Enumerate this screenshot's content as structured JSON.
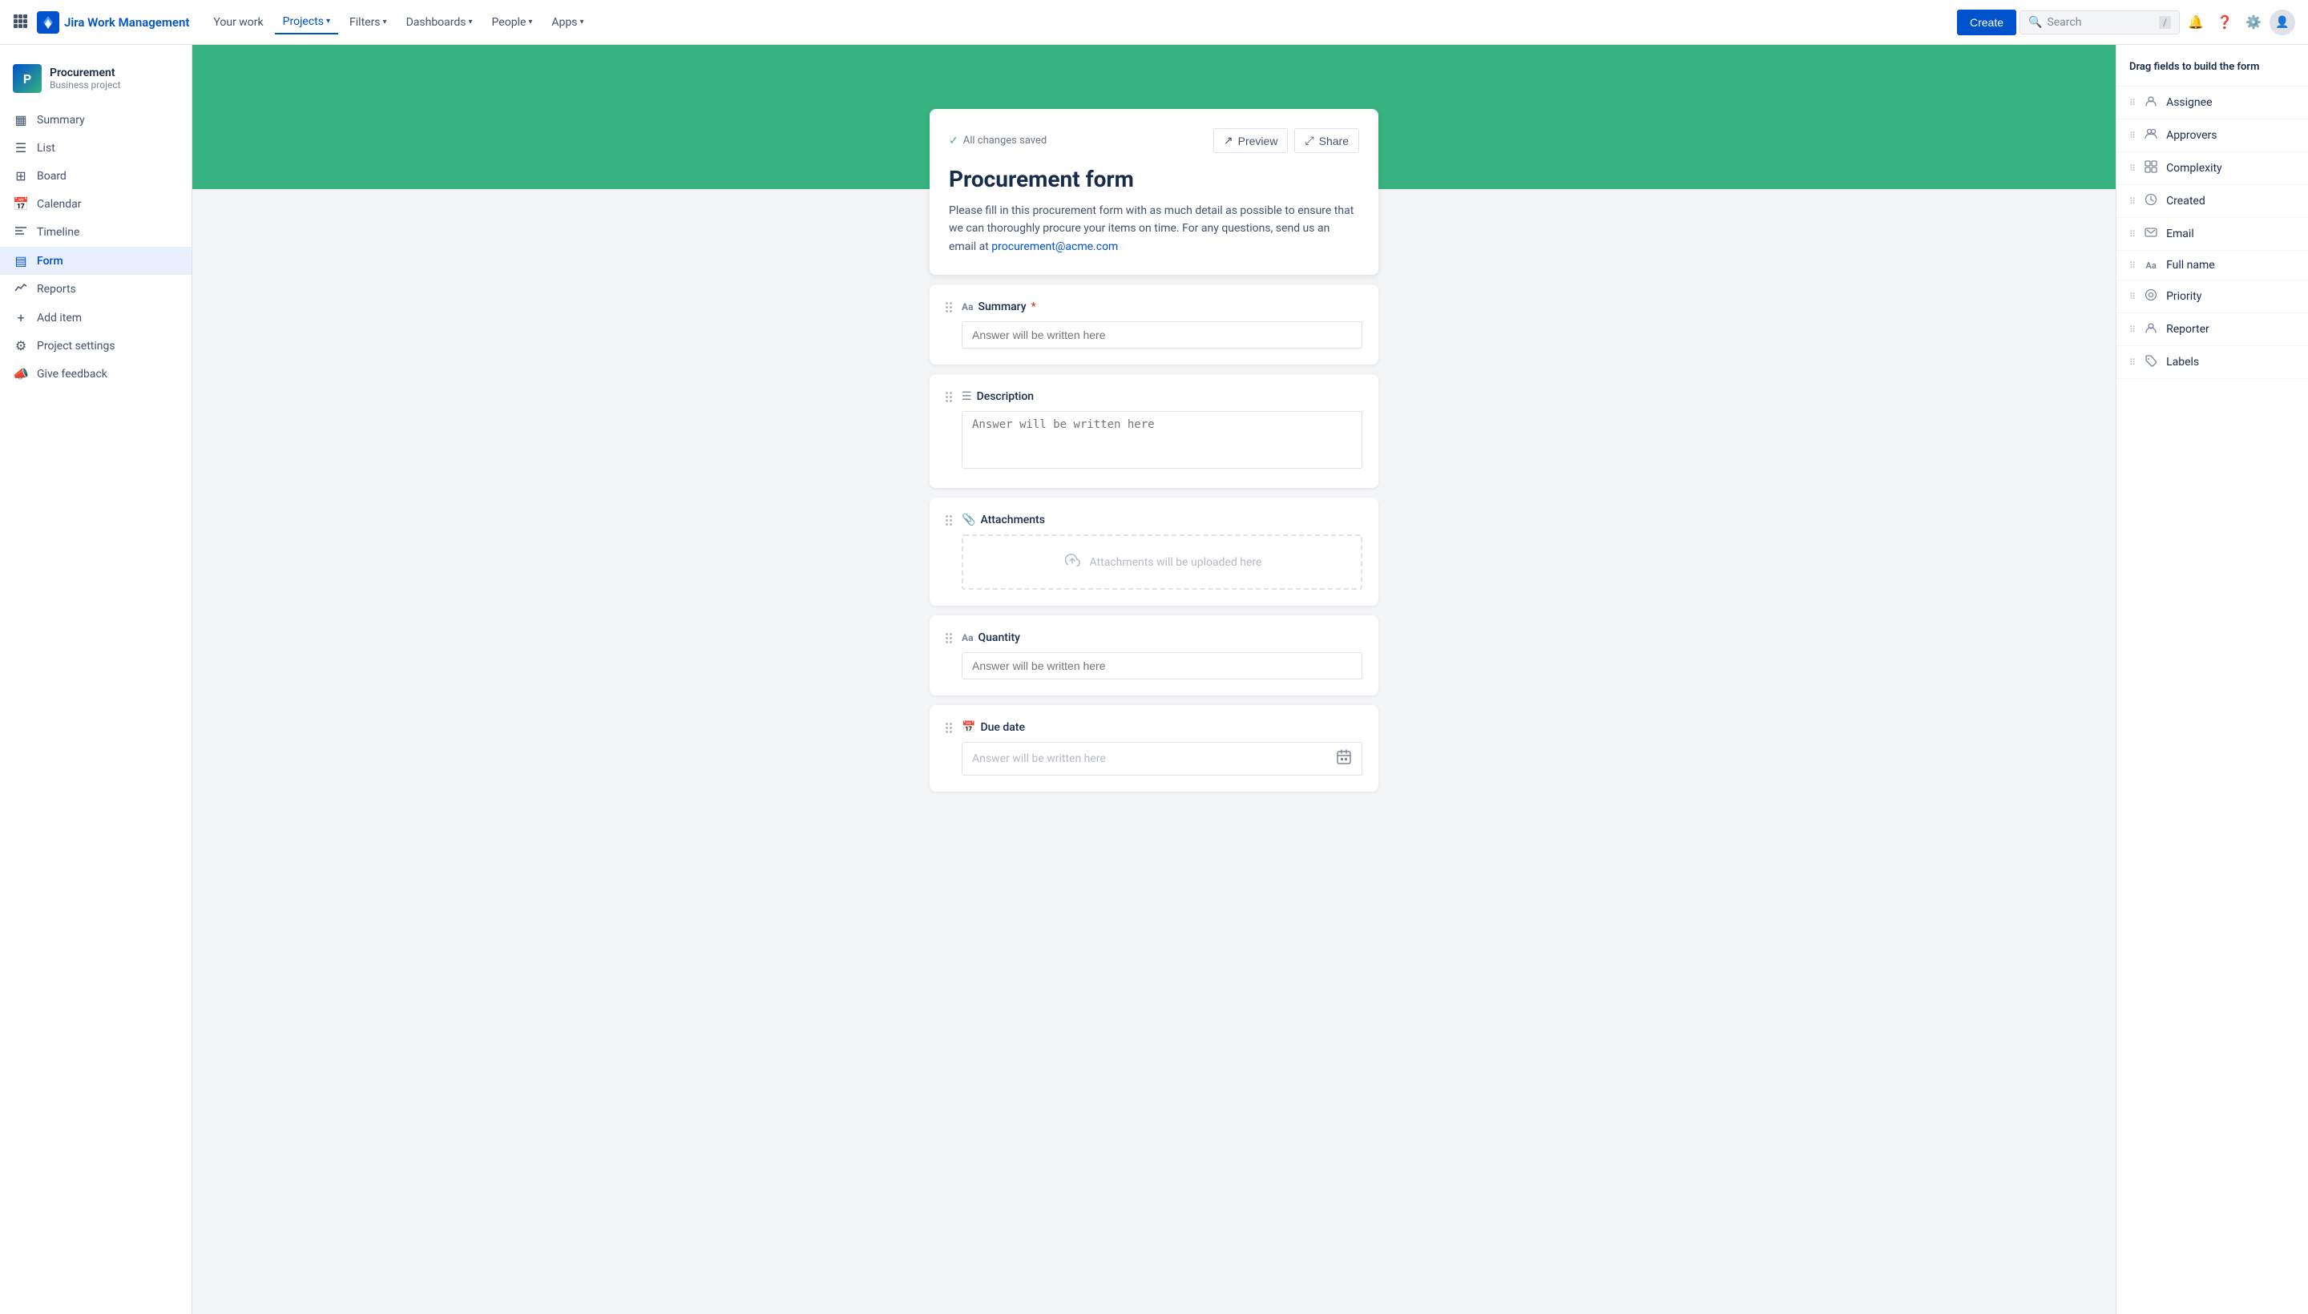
{
  "topnav": {
    "logo_text": "Jira Work Management",
    "items": [
      {
        "label": "Your work",
        "active": false
      },
      {
        "label": "Projects",
        "active": true,
        "has_chevron": true
      },
      {
        "label": "Filters",
        "active": false,
        "has_chevron": true
      },
      {
        "label": "Dashboards",
        "active": false,
        "has_chevron": true
      },
      {
        "label": "People",
        "active": false,
        "has_chevron": true
      },
      {
        "label": "Apps",
        "active": false,
        "has_chevron": true
      }
    ],
    "create_label": "Create",
    "search_placeholder": "Search",
    "search_shortcut": "/"
  },
  "sidebar": {
    "project_name": "Procurement",
    "project_type": "Business project",
    "nav_items": [
      {
        "label": "Summary",
        "icon": "▦",
        "active": false
      },
      {
        "label": "List",
        "icon": "≡",
        "active": false
      },
      {
        "label": "Board",
        "icon": "⊞",
        "active": false
      },
      {
        "label": "Calendar",
        "icon": "📅",
        "active": false
      },
      {
        "label": "Timeline",
        "icon": "≈",
        "active": false
      },
      {
        "label": "Form",
        "icon": "▤",
        "active": true
      },
      {
        "label": "Reports",
        "icon": "📈",
        "active": false
      },
      {
        "label": "Add item",
        "icon": "+",
        "active": false
      },
      {
        "label": "Project settings",
        "icon": "⚙",
        "active": false
      },
      {
        "label": "Give feedback",
        "icon": "📣",
        "active": false
      }
    ]
  },
  "form": {
    "status": "All changes saved",
    "preview_label": "Preview",
    "share_label": "Share",
    "title": "Procurement form",
    "description": "Please fill in this procurement form with as much detail as possible to ensure that we can thoroughly procure your items on time. For any questions, send us an email at",
    "email_link": "procurement@acme.com",
    "fields": [
      {
        "id": "summary",
        "label": "Summary",
        "required": true,
        "type": "text",
        "icon": "Aa",
        "placeholder": "Answer will be written here"
      },
      {
        "id": "description",
        "label": "Description",
        "required": false,
        "type": "textarea",
        "icon": "≡",
        "placeholder": "Answer will be written here"
      },
      {
        "id": "attachments",
        "label": "Attachments",
        "required": false,
        "type": "upload",
        "icon": "📎",
        "upload_text": "Attachments will be uploaded here"
      },
      {
        "id": "quantity",
        "label": "Quantity",
        "required": false,
        "type": "text",
        "icon": "Aa",
        "placeholder": "Answer will be written here"
      },
      {
        "id": "due_date",
        "label": "Due date",
        "required": false,
        "type": "date",
        "icon": "📅",
        "placeholder": "Answer will be written here"
      }
    ]
  },
  "right_panel": {
    "title": "Drag fields to build the form",
    "items": [
      {
        "label": "Assignee",
        "icon": "👤"
      },
      {
        "label": "Approvers",
        "icon": "👥"
      },
      {
        "label": "Complexity",
        "icon": "⊞"
      },
      {
        "label": "Created",
        "icon": "🕐"
      },
      {
        "label": "Email",
        "icon": "🔗"
      },
      {
        "label": "Full name",
        "icon": "Aa"
      },
      {
        "label": "Priority",
        "icon": "⊙"
      },
      {
        "label": "Reporter",
        "icon": "👤"
      },
      {
        "label": "Labels",
        "icon": "🏷"
      }
    ]
  }
}
